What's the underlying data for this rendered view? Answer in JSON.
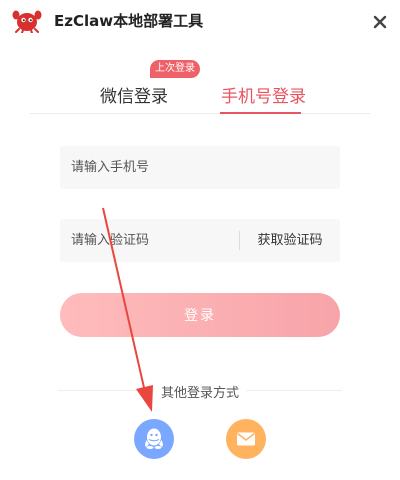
{
  "app": {
    "title": "EzClaw本地部署工具",
    "logo_icon": "red-crab-logo-icon",
    "close_icon": "close-icon"
  },
  "tabs": [
    {
      "label": "微信登录",
      "active": false,
      "badge": "上次登录"
    },
    {
      "label": "手机号登录",
      "active": true
    }
  ],
  "form": {
    "phone_placeholder": "请输入手机号",
    "phone_value": "",
    "code_placeholder": "请输入验证码",
    "code_value": "",
    "get_code_label": "获取验证码",
    "login_label": "登录"
  },
  "other_login": {
    "label": "其他登录方式",
    "methods": [
      {
        "icon": "qq-penguin-icon",
        "color": "#7aa7ff"
      },
      {
        "icon": "mail-envelope-icon",
        "color": "#ffb35f"
      }
    ]
  },
  "colors": {
    "accent": "#e8545f",
    "badge": "#ef6168",
    "login_gradient_start": "#ffbcbc",
    "login_gradient_end": "#f7a4a9",
    "annotation_arrow": "#e8463f"
  }
}
